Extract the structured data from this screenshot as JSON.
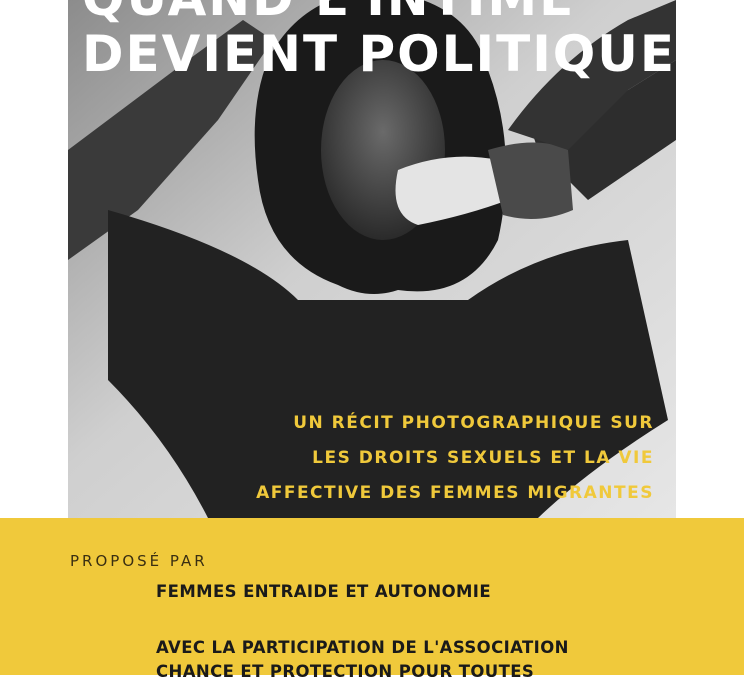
{
  "poster": {
    "title_line1": "QUAND L'INTIME",
    "title_line2": "DEVIENT POLITIQUE",
    "subtitle_lines": [
      "UN RÉCIT PHOTOGRAPHIQUE SUR",
      "LES DROITS SEXUELS ET LA VIE",
      "AFFECTIVE DES FEMMES MIGRANTES"
    ],
    "proposed_by": "PROPOSÉ PAR",
    "organizer": "FEMMES ENTRAIDE ET AUTONOMIE",
    "partner_lines": [
      "AVEC LA PARTICIPATION DE L'ASSOCIATION",
      "CHANCE ET PROTECTION POUR TOUTES"
    ]
  },
  "colors": {
    "accent_yellow": "#f0c93b",
    "title_white": "#ffffff",
    "text_dark": "#1a1a1a"
  },
  "icons": [
    "portrait-photo"
  ]
}
